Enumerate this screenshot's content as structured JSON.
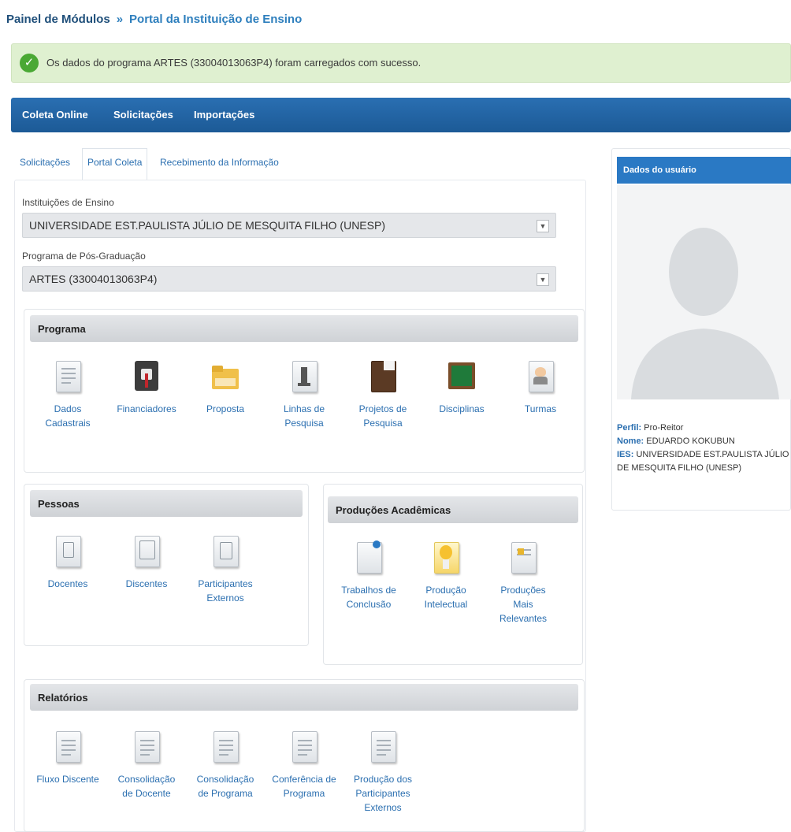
{
  "breadcrumb": {
    "root": "Painel de Módulos",
    "separator": "»",
    "current": "Portal da Instituição de Ensino"
  },
  "alert": {
    "message": "Os dados do programa ARTES (33004013063P4) foram carregados com sucesso."
  },
  "nav": {
    "items": [
      "Coleta Online",
      "Solicitações",
      "Importações"
    ]
  },
  "tabs": [
    {
      "label": "Solicitações",
      "active": false
    },
    {
      "label": "Portal Coleta",
      "active": true
    },
    {
      "label": "Recebimento da Informação",
      "active": false
    }
  ],
  "form": {
    "institution_label": "Instituições de Ensino",
    "institution_value": "UNIVERSIDADE EST.PAULISTA JÚLIO DE MESQUITA FILHO (UNESP)",
    "program_label": "Programa de Pós-Graduação",
    "program_value": "ARTES (33004013063P4)"
  },
  "sections": {
    "programa": {
      "title": "Programa",
      "items": [
        "Dados\nCadastrais",
        "Financiadores",
        "Proposta",
        "Linhas de\nPesquisa",
        "Projetos de\nPesquisa",
        "Disciplinas",
        "Turmas"
      ]
    },
    "pessoas": {
      "title": "Pessoas",
      "items": [
        "Docentes",
        "Discentes",
        "Participantes\nExternos"
      ]
    },
    "producoes": {
      "title": "Produções Acadêmicas",
      "items": [
        "Trabalhos de\nConclusão",
        "Produção\nIntelectual",
        "Produções\nMais\nRelevantes"
      ]
    },
    "relatorios": {
      "title": "Relatórios",
      "items": [
        "Fluxo Discente",
        "Consolidação\nde Docente",
        "Consolidação\nde Programa",
        "Conferência de\nPrograma",
        "Produção dos\nParticipantes\nExternos"
      ]
    }
  },
  "user": {
    "header": "Dados do usuário",
    "perfil_label": "Perfil:",
    "perfil": "Pro-Reitor",
    "nome_label": "Nome:",
    "nome": "EDUARDO KOKUBUN",
    "ies_label": "IES:",
    "ies": "UNIVERSIDADE EST.PAULISTA JÚLIO DE MESQUITA FILHO (UNESP)"
  },
  "colors": {
    "brand_blue": "#1c5a96",
    "link_blue": "#2b6fb0",
    "success_bg": "#dff0d0"
  }
}
